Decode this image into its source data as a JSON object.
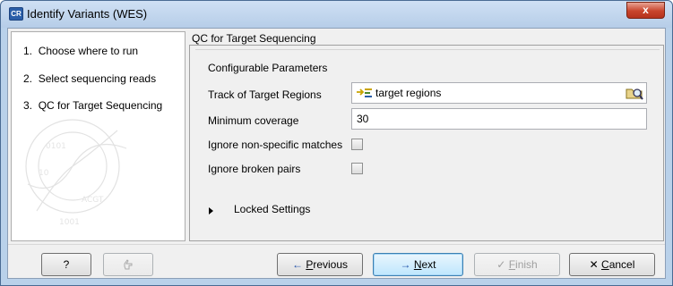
{
  "window": {
    "title": "Identify Variants (WES)",
    "app_icon_text": "CR",
    "close_glyph": "x"
  },
  "steps": [
    {
      "number": "1.",
      "label": "Choose where to run"
    },
    {
      "number": "2.",
      "label": "Select sequencing reads"
    },
    {
      "number": "3.",
      "label": "QC for Target Sequencing"
    }
  ],
  "section": {
    "title": "QC for Target Sequencing",
    "group_title": "Configurable Parameters"
  },
  "params": {
    "track_label": "Track of Target Regions",
    "track_value": "target regions",
    "min_coverage_label": "Minimum coverage",
    "min_coverage_value": "30",
    "ignore_nonspecific_label": "Ignore non-specific matches",
    "ignore_nonspecific_checked": false,
    "ignore_broken_label": "Ignore broken pairs",
    "ignore_broken_checked": false
  },
  "locked": {
    "label": "Locked Settings"
  },
  "buttons": {
    "help": "?",
    "previous_prefix": "",
    "previous_mnemonic": "P",
    "previous_rest": "revious",
    "next_mnemonic": "N",
    "next_rest": "ext",
    "finish_mnemonic": "F",
    "finish_rest": "inish",
    "cancel_mnemonic": "C",
    "cancel_rest": "ancel"
  },
  "colors": {
    "title_bar": "#b9d1ea",
    "close": "#c8442c",
    "default_button": "#bee6fd",
    "arrow_blue": "#1f4fa8"
  }
}
